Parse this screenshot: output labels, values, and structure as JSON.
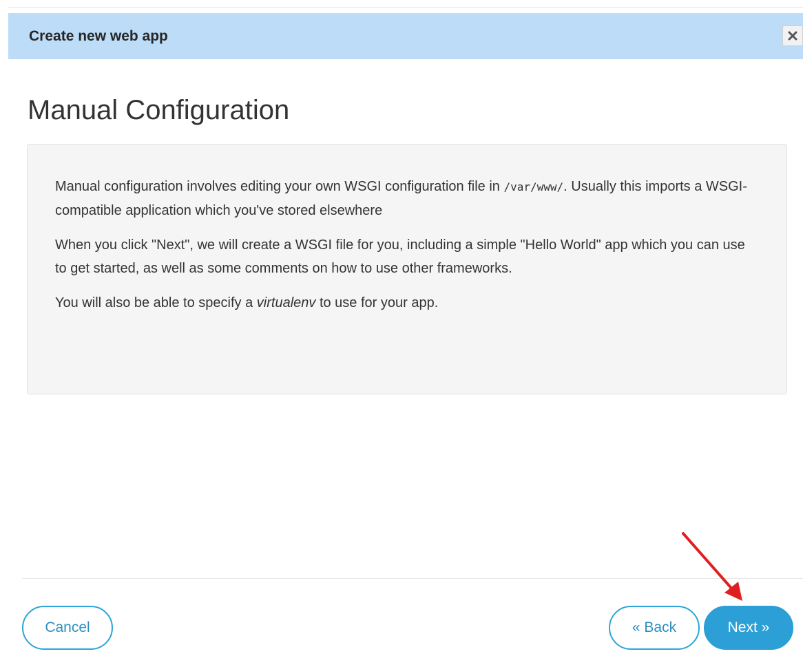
{
  "dialog": {
    "title": "Create new web app",
    "close_icon": "close-icon"
  },
  "main": {
    "heading": "Manual Configuration",
    "info": {
      "p1_before_code": "Manual configuration involves editing your own WSGI configuration file in ",
      "p1_code": "/var/www/",
      "p1_after_code": ". Usually this imports a WSGI-compatible application which you've stored elsewhere",
      "p2": "When you click \"Next\", we will create a WSGI file for you, including a simple \"Hello World\" app which you can use to get started, as well as some comments on how to use other frameworks.",
      "p3_before": "You will also be able to specify a ",
      "p3_em": "virtualenv",
      "p3_after": " to use for your app."
    }
  },
  "footer": {
    "cancel_label": "Cancel",
    "back_label": "« Back",
    "next_label": "Next »"
  },
  "colors": {
    "header_bg": "#bcdcf8",
    "accent": "#2b9fd6",
    "annotation_arrow": "#e02020"
  }
}
